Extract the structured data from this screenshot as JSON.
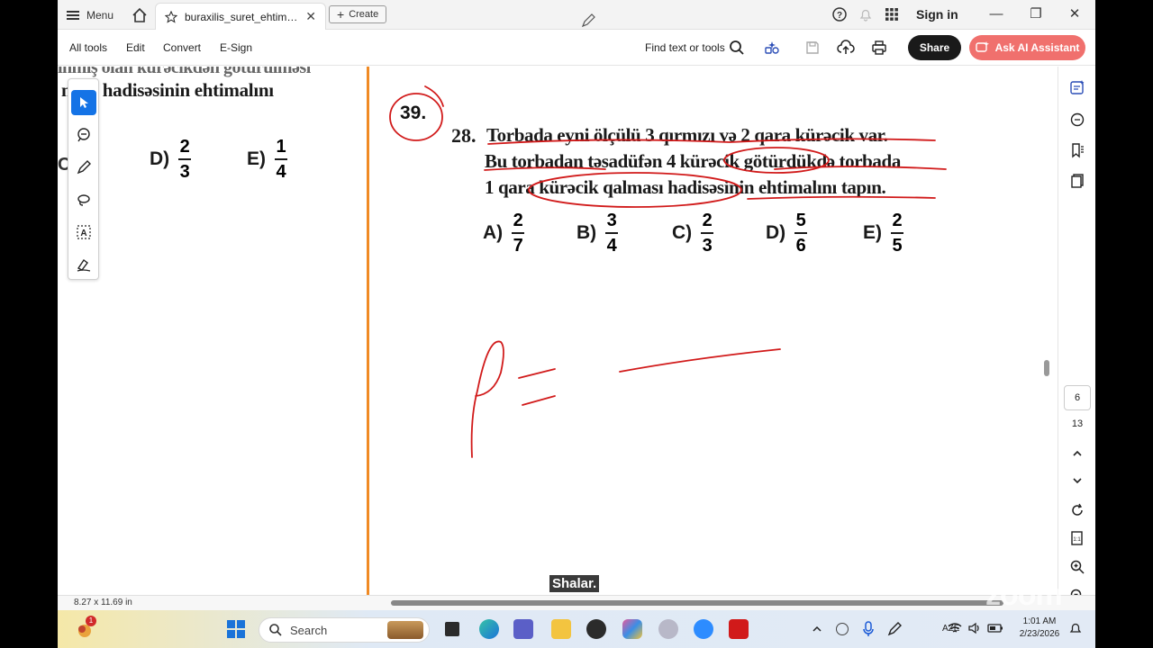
{
  "tabbar": {
    "menu_label": "Menu",
    "doc_tab_label": "buraxilis_suret_ehtimal...",
    "create_label": "Create",
    "signin_label": "Sign in"
  },
  "toolbar": {
    "all_tools": "All tools",
    "edit": "Edit",
    "convert": "Convert",
    "esign": "E-Sign",
    "find": "Find text or tools",
    "share": "Share",
    "ai_assistant": "Ask AI Assistant"
  },
  "left_page": {
    "text_line": "ması hadisəsinin ehtimalını",
    "options": [
      {
        "label": "D)",
        "num": "2",
        "den": "3"
      },
      {
        "label": "E)",
        "num": "1",
        "den": "4"
      }
    ]
  },
  "right_page": {
    "circled_number": "39.",
    "problem_number": "28.",
    "lines": [
      "Torbada eyni ölçülü 3 qırmızı və 2 qara kürəcik var.",
      "Bu torbadan təsadüfən 4 kürəcik götürdükdə torbada",
      "1 qara kürəcik qalması hadisəsinin ehtimalını tapın."
    ],
    "options": [
      {
        "label": "A)",
        "num": "2",
        "den": "7"
      },
      {
        "label": "B)",
        "num": "3",
        "den": "4"
      },
      {
        "label": "C)",
        "num": "2",
        "den": "3"
      },
      {
        "label": "D)",
        "num": "5",
        "den": "6"
      },
      {
        "label": "E)",
        "num": "2",
        "den": "5"
      }
    ]
  },
  "sidebar": {
    "current_page": "6",
    "total_pages": "13"
  },
  "status": {
    "page_size": "8.27 x 11.69 in"
  },
  "overlay": {
    "speaker_name": "Shalar.",
    "watermark": "zoom"
  },
  "taskbar": {
    "search_placeholder": "Search",
    "notification_count": "1",
    "language": "AZE",
    "time": "1:01 AM",
    "date": "2/23/2026"
  },
  "colors": {
    "accent_blue": "#1473e6",
    "ink_red": "#d11a1a",
    "divider_orange": "#f08a24",
    "ai_button": "#f0706d"
  }
}
